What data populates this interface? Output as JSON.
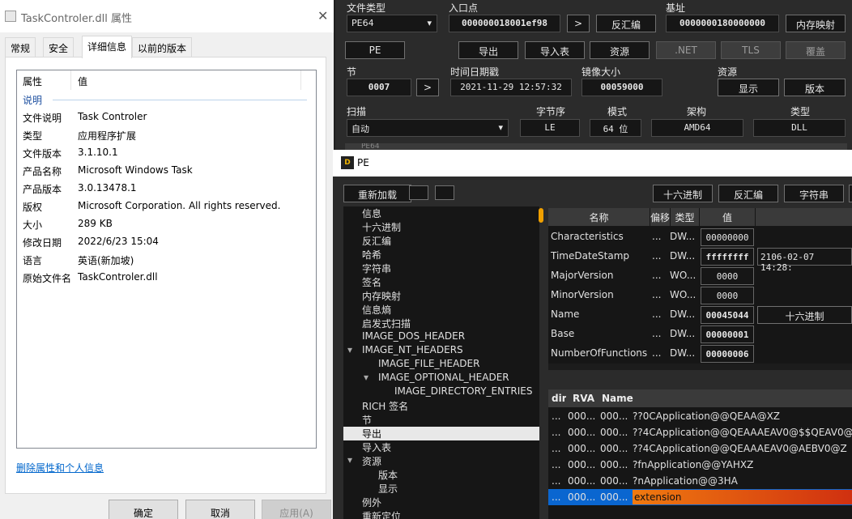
{
  "props": {
    "title": "TaskControler.dll 属性",
    "close": "✕",
    "tabs": [
      "常规",
      "安全",
      "详细信息",
      "以前的版本"
    ],
    "col_prop": "属性",
    "col_val": "值",
    "group": "说明",
    "rows": [
      {
        "k": "文件说明",
        "v": "Task Controler"
      },
      {
        "k": "类型",
        "v": "应用程序扩展"
      },
      {
        "k": "文件版本",
        "v": "3.1.10.1"
      },
      {
        "k": "产品名称",
        "v": "Microsoft Windows Task"
      },
      {
        "k": "产品版本",
        "v": "3.0.13478.1"
      },
      {
        "k": "版权",
        "v": "Microsoft Corporation. All rights reserved."
      },
      {
        "k": "大小",
        "v": "289 KB"
      },
      {
        "k": "修改日期",
        "v": "2022/6/23 15:04"
      },
      {
        "k": "语言",
        "v": "英语(新加坡)"
      },
      {
        "k": "原始文件名",
        "v": "TaskControler.dll"
      }
    ],
    "remove_link": "删除属性和个人信息",
    "ok": "确定",
    "cancel": "取消",
    "apply": "应用(A)"
  },
  "top": {
    "file_type_label": "文件类型",
    "file_type": "PE64",
    "entry_label": "入口点",
    "entry": "000000018001ef98",
    "entry_go": ">",
    "disasm": "反汇编",
    "base_label": "基址",
    "base": "0000000180000000",
    "memmap": "内存映射",
    "pe_btn": "PE",
    "export": "导出",
    "import": "导入表",
    "resource": "资源",
    "net": ".NET",
    "tls": "TLS",
    "overlay": "覆盖",
    "sections_label": "节",
    "sections": "0007",
    "sections_go": ">",
    "time_label": "时间日期戳",
    "time": "2021-11-29 12:57:32",
    "image_label": "镜像大小",
    "image": "00059000",
    "res_label": "资源",
    "res_show": "显示",
    "res_ver": "版本",
    "scan_label": "扫描",
    "scan": "自动",
    "endian_label": "字节序",
    "endian": "LE",
    "mode_label": "模式",
    "mode": "64 位",
    "arch_label": "架构",
    "arch": "AMD64",
    "type_label": "类型",
    "type": "DLL",
    "strip": "PE64"
  },
  "pe": {
    "title": "PE",
    "icon_text": "D",
    "reload": "重新加载",
    "hex": "十六进制",
    "disasm": "反汇编",
    "strings": "字符串",
    "tree": [
      {
        "t": "信息",
        "l": 0
      },
      {
        "t": "十六进制",
        "l": 0
      },
      {
        "t": "反汇编",
        "l": 0
      },
      {
        "t": "哈希",
        "l": 0
      },
      {
        "t": "字符串",
        "l": 0
      },
      {
        "t": "签名",
        "l": 0
      },
      {
        "t": "内存映射",
        "l": 0
      },
      {
        "t": "信息熵",
        "l": 0
      },
      {
        "t": "启发式扫描",
        "l": 0
      },
      {
        "t": "IMAGE_DOS_HEADER",
        "l": 0
      },
      {
        "t": "IMAGE_NT_HEADERS",
        "l": 0,
        "e": "▾"
      },
      {
        "t": "IMAGE_FILE_HEADER",
        "l": 1
      },
      {
        "t": "IMAGE_OPTIONAL_HEADER",
        "l": 1,
        "e": "▾"
      },
      {
        "t": "IMAGE_DIRECTORY_ENTRIES",
        "l": 2
      },
      {
        "t": "RICH 签名",
        "l": 0
      },
      {
        "t": "节",
        "l": 0
      },
      {
        "t": "导出",
        "l": 0,
        "sel": true
      },
      {
        "t": "导入表",
        "l": 0
      },
      {
        "t": "资源",
        "l": 0,
        "e": "▾"
      },
      {
        "t": "版本",
        "l": 1
      },
      {
        "t": "显示",
        "l": 1
      },
      {
        "t": "例外",
        "l": 0
      },
      {
        "t": "重新定位",
        "l": 0
      }
    ],
    "hdr_name": "名称",
    "hdr_off": "偏移",
    "hdr_type": "类型",
    "hdr_val": "值",
    "fields": [
      {
        "n": "Characteristics",
        "o": "...",
        "t": "DW...",
        "v": "00000000",
        "b": false
      },
      {
        "n": "TimeDateStamp",
        "o": "...",
        "t": "DW...",
        "v": "ffffffff",
        "b": true,
        "x": "2106-02-07 14:28:"
      },
      {
        "n": "MajorVersion",
        "o": "...",
        "t": "WO...",
        "v": "0000",
        "b": false
      },
      {
        "n": "MinorVersion",
        "o": "...",
        "t": "WO...",
        "v": "0000",
        "b": false
      },
      {
        "n": "Name",
        "o": "...",
        "t": "DW...",
        "v": "00045044",
        "b": true,
        "x": "十六进制"
      },
      {
        "n": "Base",
        "o": "...",
        "t": "DW...",
        "v": "00000001",
        "b": true
      },
      {
        "n": "NumberOfFunctions",
        "o": "...",
        "t": "DW...",
        "v": "00000006",
        "b": true
      }
    ],
    "exp_hdr": [
      "dir",
      "RVA",
      "Name"
    ],
    "exports": [
      {
        "a": "...",
        "b": "000...",
        "c": "000...",
        "n": "??0CApplication@@QEAA@XZ"
      },
      {
        "a": "...",
        "b": "000...",
        "c": "000...",
        "n": "??4CApplication@@QEAAAEAV0@$$QEAV0@"
      },
      {
        "a": "...",
        "b": "000...",
        "c": "000...",
        "n": "??4CApplication@@QEAAAEAV0@AEBV0@Z"
      },
      {
        "a": "...",
        "b": "000...",
        "c": "000...",
        "n": "?fnApplication@@YAHXZ"
      },
      {
        "a": "...",
        "b": "000...",
        "c": "000...",
        "n": "?nApplication@@3HA"
      },
      {
        "a": "...",
        "b": "000...",
        "c": "000...",
        "n": "extension",
        "sel": true
      }
    ],
    "accent": "#d06a10",
    "sel_row": "#0a66d0"
  }
}
